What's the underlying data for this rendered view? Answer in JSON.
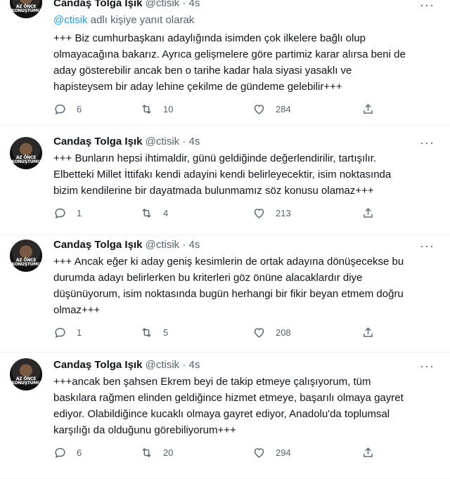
{
  "tweets": [
    {
      "name": "Candaş Tolga Işık",
      "handle": "@ctisik",
      "time": "4s",
      "avatar_text": "AZ ÖNCE\nKONUŞTUMU",
      "reply_to_handle": "@ctisik",
      "reply_to_text": " adlı kişiye yanıt olarak",
      "text_lines": [
        "+++ Biz cumhurbaşkanı adaylığında  isimden çok ilkelere bağlı olup",
        "olmayacağına bakarız. Ayrıca gelişmelere göre partimiz karar alırsa beni de",
        "aday gösterebilir ancak ben o tarihe kadar hala siyasi yasaklı ve",
        "hapisteysem bir aday lehine çekilme de gündeme gelebilir+++"
      ],
      "replies": "6",
      "retweets": "10",
      "likes": "284"
    },
    {
      "name": "Candaş Tolga Işık",
      "handle": "@ctisik",
      "time": "4s",
      "avatar_text": "AZ ÖNCE\nKONUŞTUMU",
      "text_lines": [
        "+++ Bunların hepsi ihtimaldir, günü geldiğinde değerlendirilir, tartışılır.",
        "Elbetteki Millet İttifakı kendi adayini kendi belirleyecektir, isim noktasında",
        "bizim kendilerine bir dayatmada bulunmamız söz konusu olamaz+++"
      ],
      "replies": "1",
      "retweets": "4",
      "likes": "213"
    },
    {
      "name": "Candaş Tolga Işık",
      "handle": "@ctisik",
      "time": "4s",
      "avatar_text": "AZ ÖNCE\nKONUŞTUMU",
      "text_lines": [
        "+++ Ancak eğer ki aday geniş kesimlerin de ortak adayına dönüşecekse bu",
        "durumda adayı belirlerken bu kriterleri göz önüne alacaklardır diye",
        "düşünüyorum, isim noktasında bugün herhangi bir fikir beyan etmem doğru",
        "olmaz+++"
      ],
      "replies": "1",
      "retweets": "5",
      "likes": "208"
    },
    {
      "name": "Candaş Tolga Işık",
      "handle": "@ctisik",
      "time": "4s",
      "avatar_text": "AZ ÖNCE\nKONUŞTUMU",
      "text_lines": [
        "+++ancak ben şahsen Ekrem beyi de takip etmeye çalışıyorum, tüm",
        "baskılara rağmen elinden geldiğince hizmet etmeye, başarılı olmaya gayret",
        "ediyor. Olabildiğince kucaklı olmaya gayret ediyor, Anadolu'da toplumsal",
        "karşılığı da olduğunu görebiliyorum+++"
      ],
      "replies": "6",
      "retweets": "20",
      "likes": "294"
    }
  ],
  "separator": " · ",
  "more_icon": "···",
  "colors": {
    "accent": "#1d9bf0",
    "secondary": "#536471",
    "text": "#0f1419"
  }
}
